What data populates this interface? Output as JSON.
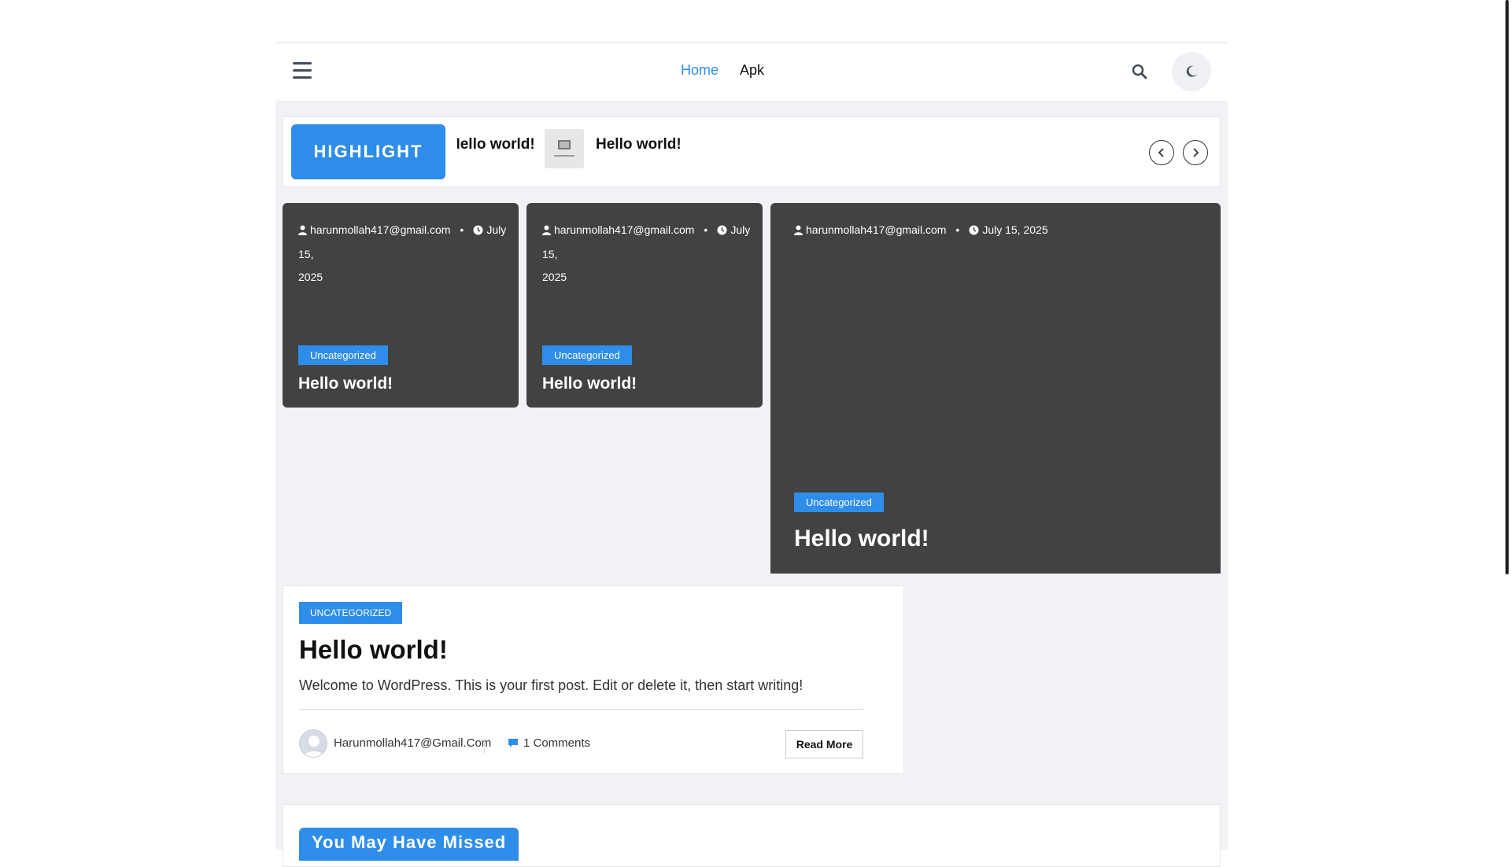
{
  "nav": {
    "items": [
      {
        "label": "Home"
      },
      {
        "label": "Apk"
      }
    ]
  },
  "ticker": {
    "label": "HIGHLIGHT",
    "items": [
      {
        "title": "Hello world!"
      },
      {
        "title": "Hello world!"
      }
    ]
  },
  "cards": [
    {
      "author": "harunmollah417@gmail.com",
      "date_a": "July 15,",
      "date_b": "2025",
      "category": "Uncategorized",
      "title": "Hello world!"
    },
    {
      "author": "harunmollah417@gmail.com",
      "date_a": "July 15,",
      "date_b": "2025",
      "category": "Uncategorized",
      "title": "Hello world!"
    },
    {
      "author": "harunmollah417@gmail.com",
      "date_a": "July 15, 2025",
      "category": "Uncategorized",
      "title": "Hello world!"
    }
  ],
  "post": {
    "category": "UNCATEGORIZED",
    "title": "Hello world!",
    "excerpt": "Welcome to WordPress. This is your first post. Edit or delete it, then start writing!",
    "author": "Harunmollah417@Gmail.Com",
    "comments": "1 Comments",
    "read_more": "Read More"
  },
  "missed": {
    "title": "You May Have Missed"
  },
  "colors": {
    "accent": "#2e8de8",
    "card_bg": "#424242",
    "page_bg": "#f1f2f6"
  },
  "icons": [
    "menu-icon",
    "search-icon",
    "moon-icon",
    "user-icon",
    "clock-icon",
    "chevron-left-icon",
    "chevron-right-icon",
    "comment-icon",
    "avatar-icon"
  ]
}
